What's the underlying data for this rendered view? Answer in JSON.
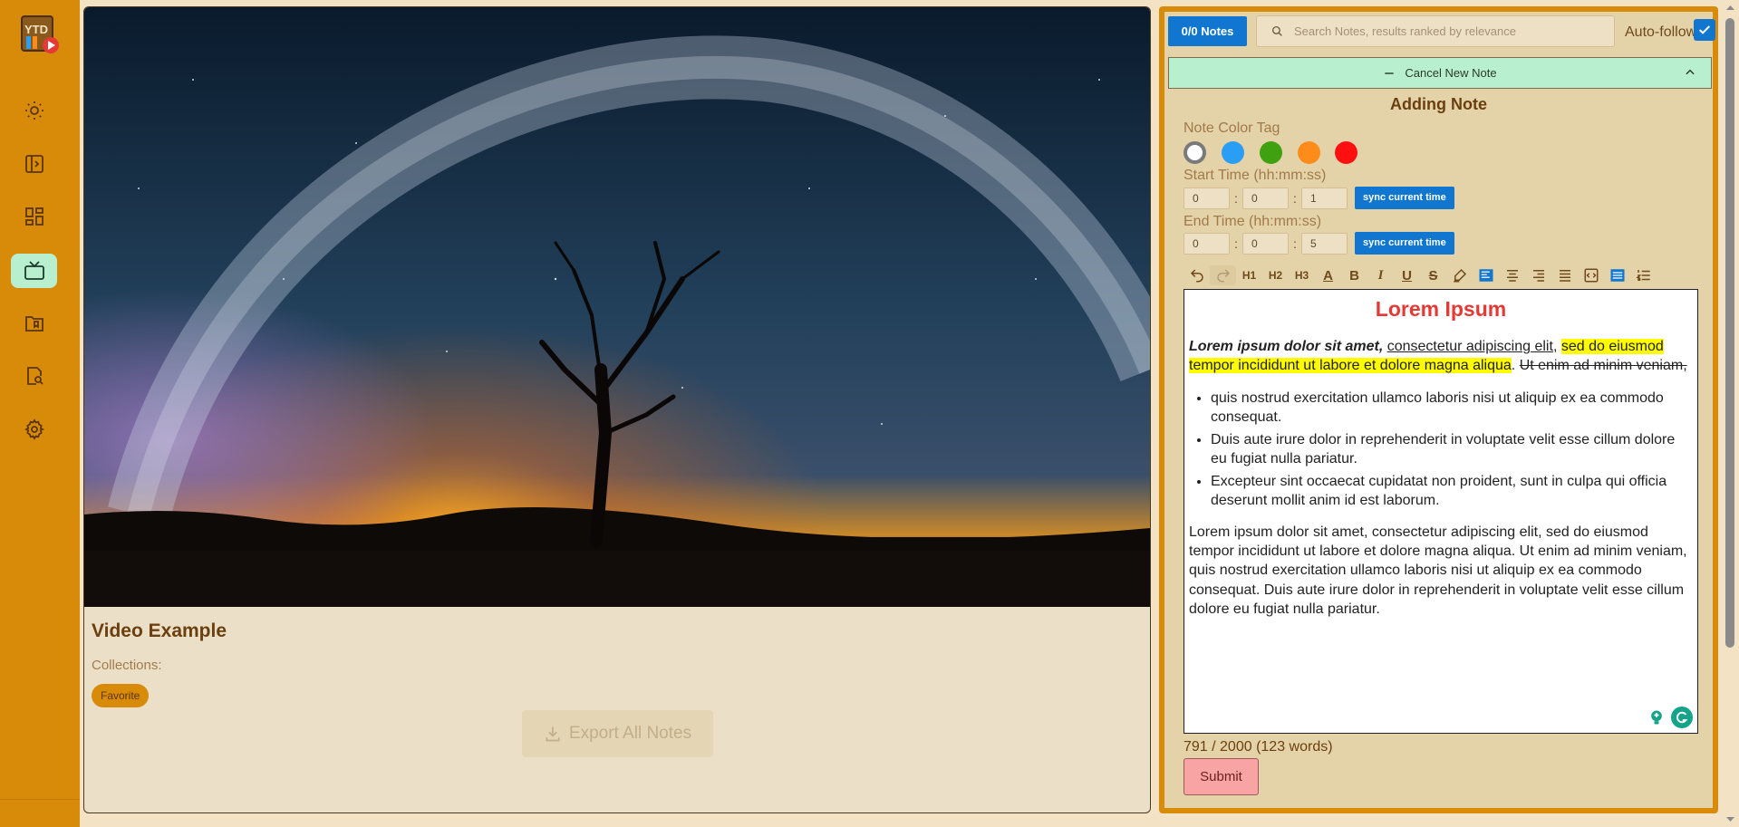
{
  "sidebar": {
    "logo_text": "YTD",
    "items": [
      {
        "icon": "sun-icon"
      },
      {
        "icon": "panel-expand-icon"
      },
      {
        "icon": "dashboard-icon"
      },
      {
        "icon": "tv-icon",
        "active": true
      },
      {
        "icon": "folder-bookmark-icon"
      },
      {
        "icon": "document-search-icon"
      },
      {
        "icon": "gear-icon"
      }
    ]
  },
  "video": {
    "title": "Video Example",
    "collections_label": "Collections:",
    "tags": [
      "Favorite"
    ],
    "export_label": "Export All Notes"
  },
  "notes": {
    "count_label": "0/0 Notes",
    "search_placeholder": "Search Notes, results ranked by relevance",
    "auto_follow_label": "Auto-follow",
    "auto_follow_checked": true,
    "cancel_label": "Cancel New Note",
    "form_title": "Adding Note",
    "color_tag_label": "Note Color Tag",
    "colors": [
      "#ffffff",
      "#2a9df4",
      "#3fa10f",
      "#ff8c1a",
      "#ff1010"
    ],
    "start_label": "Start Time (hh:mm:ss)",
    "start": {
      "h": "0",
      "m": "0",
      "s": "1"
    },
    "end_label": "End Time (hh:mm:ss)",
    "end": {
      "h": "0",
      "m": "0",
      "s": "5"
    },
    "sync_label": "sync current time",
    "editor": {
      "title": "Lorem Ipsum",
      "p1_bold_italic": "Lorem ipsum dolor sit amet,",
      "p1_underline": "consectetur adipiscing elit",
      "p1_comma": ",",
      "p1_highlight": "sed do eiusmod tempor incididunt ut labore et dolore magna aliqua",
      "p1_dot": ".",
      "p1_strike": "Ut enim ad minim veniam,",
      "bullets": [
        "quis nostrud exercitation ullamco laboris nisi ut aliquip ex ea commodo consequat.",
        "Duis aute irure dolor in reprehenderit in voluptate velit esse cillum dolore eu fugiat nulla pariatur.",
        "Excepteur sint occaecat cupidatat non proident, sunt in culpa qui officia deserunt mollit anim id est laborum."
      ],
      "p2": "Lorem ipsum dolor sit amet, consectetur adipiscing elit, sed do eiusmod tempor incididunt ut labore et dolore magna aliqua. Ut enim ad minim veniam, quis nostrud exercitation ullamco laboris nisi ut aliquip ex ea commodo consequat. Duis aute irure dolor in reprehenderit in voluptate velit esse cillum dolore eu fugiat nulla pariatur."
    },
    "char_count": "791 / 2000 (123 words)",
    "submit_label": "Submit"
  },
  "toolbar": {
    "h1": "H1",
    "h2": "H2",
    "h3": "H3",
    "bold": "B",
    "italic": "I",
    "underline": "U",
    "strike": "S",
    "font_color": "A"
  }
}
